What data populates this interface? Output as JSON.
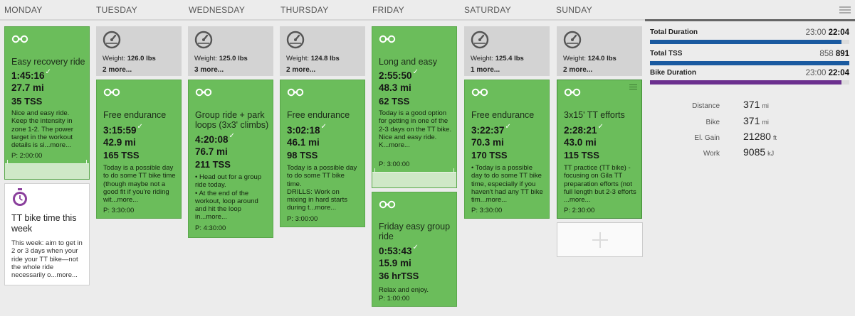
{
  "days": [
    "MONDAY",
    "TUESDAY",
    "WEDNESDAY",
    "THURSDAY",
    "FRIDAY",
    "SATURDAY",
    "SUNDAY"
  ],
  "colors": {
    "workout_green": "#6bbd5b",
    "metrics_gray": "#d3d3d3",
    "bar_blue": "#1a5aa0",
    "bar_purple": "#6b2f8e",
    "bar_gray": "#dddddd"
  },
  "icons": {
    "bike": "bike-icon",
    "scale": "scale-icon",
    "stopwatch": "stopwatch-icon",
    "check": "checkmark-icon",
    "menu": "menu-icon",
    "add": "plus-icon"
  },
  "cards": {
    "mon_ride": {
      "title": "Easy recovery ride",
      "duration": "1:45:16",
      "distance": "27.7 mi",
      "tss": "35 TSS",
      "desc": "Nice and easy ride. Keep the intensity in zone 1-2. The power target in the workout details is si...more...",
      "planned": "P: 2:00:00"
    },
    "mon_event": {
      "title": "TT bike time this week",
      "desc": "This week: aim to get in 2 or 3 days when your ride your TT bike—not the whole ride necessarily o...more..."
    },
    "tue_metrics": {
      "weight_label": "Weight:",
      "weight": "126.0 lbs",
      "more": "2 more..."
    },
    "tue_ride": {
      "title": "Free endurance",
      "duration": "3:15:59",
      "distance": "42.9 mi",
      "tss": "165 TSS",
      "desc": "Today is a possible day to do some TT bike time (though maybe not a good fit if you're riding wit...more...",
      "planned": "P: 3:30:00"
    },
    "wed_metrics": {
      "weight_label": "Weight:",
      "weight": "125.0 lbs",
      "more": "3 more..."
    },
    "wed_ride": {
      "title": "Group ride + park loops (3x3' climbs)",
      "duration": "4:20:08",
      "distance": "76.7 mi",
      "tss": "211 TSS",
      "desc": "• Head out for a group ride today.\n• At the end of the workout, loop around and hit the loop in...more...",
      "planned": "P: 4:30:00"
    },
    "thu_metrics": {
      "weight_label": "Weight:",
      "weight": "124.8 lbs",
      "more": "2 more..."
    },
    "thu_ride": {
      "title": "Free endurance",
      "duration": "3:02:18",
      "distance": "46.1 mi",
      "tss": "98 TSS",
      "desc": "Today is a possible day to do some TT bike time.\nDRILLS: Work on mixing in hard starts during t...more...",
      "planned": "P: 3:00:00"
    },
    "fri_ride1": {
      "title": "Long and easy",
      "duration": "2:55:50",
      "distance": "48.3 mi",
      "tss": "62 TSS",
      "desc": "Today is a good option for getting in one of the 2-3 days on the TT bike.\nNice and easy ride.\nK...more...",
      "planned": "P: 3:00:00"
    },
    "fri_ride2": {
      "title": "Friday easy group ride",
      "duration": "0:53:43",
      "distance": "15.9 mi",
      "tss": "36 hrTSS",
      "desc": "Relax and enjoy.",
      "planned": "P: 1:00:00"
    },
    "sat_metrics": {
      "weight_label": "Weight:",
      "weight": "125.4 lbs",
      "more": "1 more..."
    },
    "sat_ride": {
      "title": "Free endurance",
      "duration": "3:22:37",
      "distance": "70.3 mi",
      "tss": "170 TSS",
      "desc": "• Today is a possible day to do some TT bike time, especially if you haven't had any TT bike tim...more...",
      "planned": "P: 3:30:00"
    },
    "sun_metrics": {
      "weight_label": "Weight:",
      "weight": "124.0 lbs",
      "more": "2 more..."
    },
    "sun_ride": {
      "title": "3x15' TT efforts",
      "duration": "2:28:21",
      "distance": "43.0 mi",
      "tss": "115 TSS",
      "desc": "TT practice (TT bike) - focusing on Gila TT preparation efforts (not full length but 2-3 efforts ...more...",
      "planned": "P: 2:30:00"
    }
  },
  "summary": {
    "total_duration": {
      "label": "Total Duration",
      "planned": "23:00",
      "completed": "22:04",
      "fill": 0.96
    },
    "total_tss": {
      "label": "Total TSS",
      "planned": "858",
      "completed": "891",
      "fill": 1.0
    },
    "bike_duration": {
      "label": "Bike Duration",
      "planned": "23:00",
      "completed": "22:04",
      "fill": 0.96
    }
  },
  "stats": {
    "distance": {
      "label": "Distance",
      "value": "371",
      "unit": "mi"
    },
    "bike": {
      "label": "Bike",
      "value": "371",
      "unit": "mi"
    },
    "el_gain": {
      "label": "El. Gain",
      "value": "21280",
      "unit": "ft"
    },
    "work": {
      "label": "Work",
      "value": "9085",
      "unit": "kJ"
    }
  }
}
